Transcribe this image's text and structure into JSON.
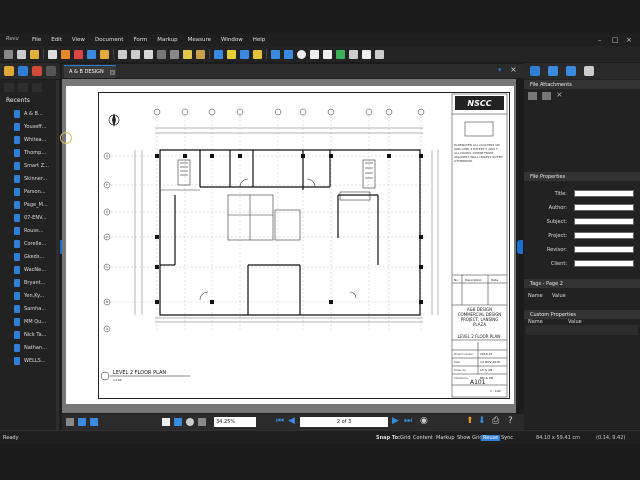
{
  "app": {
    "logo_text": "Revu",
    "menu": [
      "File",
      "Edit",
      "View",
      "Document",
      "Form",
      "Markup",
      "Measure",
      "Window",
      "Help"
    ]
  },
  "document_tab": {
    "label": "A & B DESIGN"
  },
  "left_panel": {
    "recents_header": "Recents",
    "items": [
      "A & B...",
      "Youseff...",
      "Whitea...",
      "Thomp...",
      "Smart Z...",
      "Skinner...",
      "Parson...",
      "Page_M...",
      "07-ENV...",
      "Rouss...",
      "Corelle...",
      "Gkeds...",
      "WacNe...",
      "Bryant...",
      "Yen,Ky...",
      "Samha...",
      "MM Qu...",
      "Nick Ta...",
      "Nathan...",
      "WELLS..."
    ]
  },
  "right_panel": {
    "file_attachments": "File Attachments",
    "file_properties": "File Properties",
    "fields": [
      "Title:",
      "Author:",
      "Subject:",
      "Project:",
      "Revisor:",
      "Client:"
    ],
    "tags_header": "Tags - Page 2",
    "tags_columns": [
      "Name",
      "Value"
    ],
    "custom_header": "Custom Properties",
    "custom_columns": [
      "Name",
      "Value"
    ]
  },
  "drawing": {
    "firm_logo": "NSCC",
    "notes": "ELIMINATED ALL COLUMNS ON GRID LINE 3 EXCEPT 5 AND 7. ALL DOORS 150MM FROM ADJACENT WALL UNLESS NOTED OTHERWISE.",
    "rev_columns": [
      "No.",
      "Description",
      "Date"
    ],
    "project_title": "A&B DESIGN COMMERCIAL DESIGN PROJECT, LANSING PLAZA",
    "sheet_name": "LEVEL 2 FLOOR PLAN",
    "meta_labels": [
      "Project number",
      "Date",
      "Drawn by",
      "Checked by"
    ],
    "meta_values": [
      "2018-07",
      "14 NOV 2018",
      "LH & AB",
      "BM & KB"
    ],
    "sheet_number": "A101",
    "scale": "1 : 100",
    "view_title": "LEVEL 2 FLOOR PLAN",
    "view_scale": "1:100",
    "grid_letters": [
      "G",
      "F",
      "E",
      "D",
      "C",
      "B",
      "A"
    ]
  },
  "navbar": {
    "zoom": "34.25%",
    "page": "2 of 3"
  },
  "status": {
    "ready": "Ready",
    "snap_to": "Snap To:",
    "snap_opts": [
      "Grid",
      "Content",
      "Markup",
      "Show Grid",
      "Reuse",
      "Sync"
    ],
    "dims": "84.10 x 59.41 cm",
    "cursor": "(0.14, 9.42)"
  },
  "colors": {
    "accent": "#2f7fd6",
    "toolbar_bg": "#232323",
    "panel_bg": "#222222"
  }
}
